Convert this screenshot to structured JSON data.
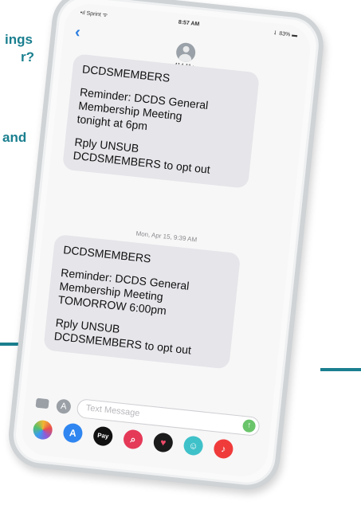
{
  "background": {
    "partial_text_lines": [
      "ings",
      "r?",
      "and"
    ],
    "accent_color": "#1a7f8f"
  },
  "phone": {
    "status": {
      "carrier": "•ıl Sprint ᯤ",
      "time": "8:57 AM",
      "battery": "⇃ 83% ▬"
    },
    "back_icon": "chevron-left",
    "contact": {
      "name": "414-11 ›"
    },
    "messages": [
      {
        "sender": "DCDSMEMBERS",
        "body": "Reminder: DCDS General\nMembership Meeting\ntonight at 6pm",
        "footer": "Rply UNSUB\nDCDSMEMBERS to opt out"
      },
      {
        "sender": "DCDSMEMBERS",
        "body": "Reminder: DCDS General\nMembership Meeting\nTOMORROW 6:00pm",
        "footer": "Rply UNSUB\nDCDSMEMBERS to opt out"
      }
    ],
    "timestamp": "Mon, Apr 15, 9:39 AM",
    "composer": {
      "placeholder": "Text Message",
      "camera_icon": "camera-icon",
      "apps_icon": "app-store-icon",
      "send_icon": "arrow-up-icon"
    },
    "app_drawer": [
      {
        "name": "photos-icon",
        "color": "#f2b632"
      },
      {
        "name": "app-store-icon",
        "color": "#2f86f0",
        "glyph": "A"
      },
      {
        "name": "apple-pay-icon",
        "color": "#111111",
        "glyph": "Pay"
      },
      {
        "name": "image-search-icon",
        "color": "#e53958",
        "glyph": "⌕"
      },
      {
        "name": "digital-touch-icon",
        "color": "#1b1b1b",
        "glyph": "♥"
      },
      {
        "name": "animoji-icon",
        "color": "#3fc1c9",
        "glyph": "☺"
      },
      {
        "name": "music-icon",
        "color": "#f03b3b",
        "glyph": "♪"
      }
    ]
  }
}
